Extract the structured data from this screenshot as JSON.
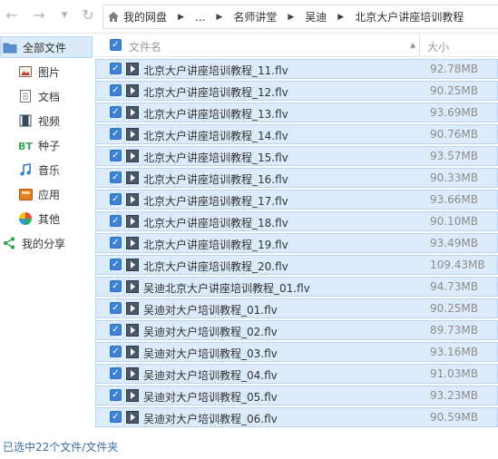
{
  "breadcrumb": [
    "我的网盘",
    "...",
    "名师讲堂",
    "吴迪",
    "北京大户讲座培训教程"
  ],
  "sidebar": {
    "items": [
      {
        "label": "全部文件",
        "icon": "folder-icon",
        "active": true
      },
      {
        "label": "图片",
        "icon": "image-icon",
        "active": false
      },
      {
        "label": "文档",
        "icon": "document-icon",
        "active": false
      },
      {
        "label": "视频",
        "icon": "video-icon",
        "active": false
      },
      {
        "label": "种子",
        "icon": "bt-icon",
        "active": false
      },
      {
        "label": "音乐",
        "icon": "music-icon",
        "active": false
      },
      {
        "label": "应用",
        "icon": "app-icon",
        "active": false
      },
      {
        "label": "其他",
        "icon": "other-icon",
        "active": false
      },
      {
        "label": "我的分享",
        "icon": "share-icon",
        "active": false
      }
    ]
  },
  "list": {
    "headers": {
      "name": "文件名",
      "size": "大小"
    },
    "files": [
      {
        "name": "北京大户讲座培训教程_11.flv",
        "size": "92.78MB",
        "checked": true
      },
      {
        "name": "北京大户讲座培训教程_12.flv",
        "size": "90.25MB",
        "checked": true
      },
      {
        "name": "北京大户讲座培训教程_13.flv",
        "size": "93.69MB",
        "checked": true
      },
      {
        "name": "北京大户讲座培训教程_14.flv",
        "size": "90.76MB",
        "checked": true
      },
      {
        "name": "北京大户讲座培训教程_15.flv",
        "size": "93.57MB",
        "checked": true
      },
      {
        "name": "北京大户讲座培训教程_16.flv",
        "size": "90.33MB",
        "checked": true
      },
      {
        "name": "北京大户讲座培训教程_17.flv",
        "size": "93.66MB",
        "checked": true
      },
      {
        "name": "北京大户讲座培训教程_18.flv",
        "size": "90.10MB",
        "checked": true
      },
      {
        "name": "北京大户讲座培训教程_19.flv",
        "size": "93.49MB",
        "checked": true
      },
      {
        "name": "北京大户讲座培训教程_20.flv",
        "size": "109.43MB",
        "checked": true
      },
      {
        "name": "吴迪北京大户讲座培训教程_01.flv",
        "size": "94.73MB",
        "checked": true
      },
      {
        "name": "吴迪对大户培训教程_01.flv",
        "size": "90.25MB",
        "checked": true
      },
      {
        "name": "吴迪对大户培训教程_02.flv",
        "size": "89.73MB",
        "checked": true
      },
      {
        "name": "吴迪对大户培训教程_03.flv",
        "size": "93.16MB",
        "checked": true
      },
      {
        "name": "吴迪对大户培训教程_04.flv",
        "size": "91.03MB",
        "checked": true
      },
      {
        "name": "吴迪对大户培训教程_05.flv",
        "size": "93.23MB",
        "checked": true
      },
      {
        "name": "吴迪对大户培训教程_06.flv",
        "size": "90.59MB",
        "checked": true
      }
    ]
  },
  "status": {
    "text": "已选中22个文件/文件夹"
  }
}
